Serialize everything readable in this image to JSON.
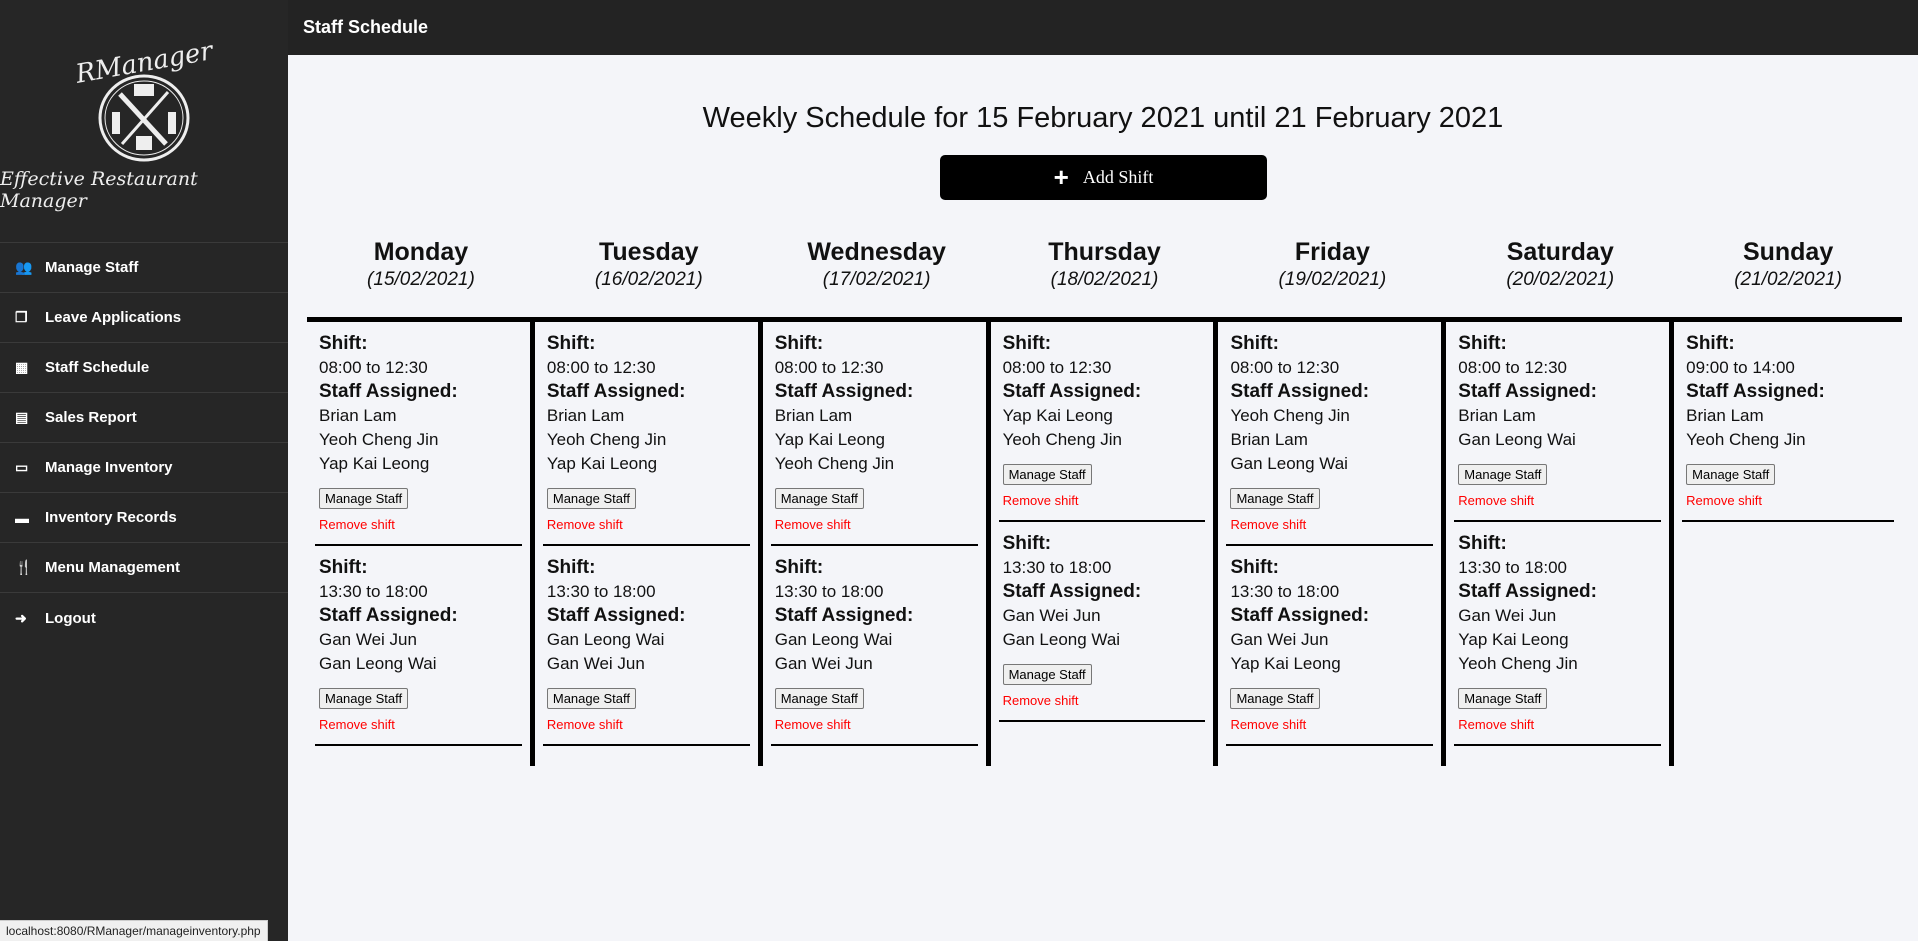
{
  "sidebar": {
    "logo_title": "RManager",
    "logo_subtitle": "Effective Restaurant Manager",
    "items": [
      {
        "label": "Manage Staff",
        "icon": "users-icon",
        "glyph": "👥"
      },
      {
        "label": "Leave Applications",
        "icon": "copy-icon",
        "glyph": "❐"
      },
      {
        "label": "Staff Schedule",
        "icon": "calendar-icon",
        "glyph": "▦"
      },
      {
        "label": "Sales Report",
        "icon": "file-icon",
        "glyph": "▤"
      },
      {
        "label": "Manage Inventory",
        "icon": "warehouse-icon",
        "glyph": "▭"
      },
      {
        "label": "Inventory Records",
        "icon": "book-icon",
        "glyph": "▬"
      },
      {
        "label": "Menu Management",
        "icon": "utensils-icon",
        "glyph": "🍴"
      },
      {
        "label": "Logout",
        "icon": "sign-out-icon",
        "glyph": "➜"
      }
    ]
  },
  "header": {
    "title": "Staff Schedule"
  },
  "main": {
    "title": "Weekly Schedule for 15 February 2021 until 21 February 2021",
    "add_shift": "Add Shift",
    "labels": {
      "shift": "Shift:",
      "staff": "Staff Assigned:",
      "manage": "Manage Staff",
      "remove": "Remove shift"
    },
    "days": [
      {
        "name": "Monday",
        "date": "(15/02/2021)",
        "shifts": [
          {
            "time": "08:00 to 12:30",
            "staff": [
              "Brian Lam",
              "Yeoh Cheng Jin",
              "Yap Kai Leong"
            ]
          },
          {
            "time": "13:30 to 18:00",
            "staff": [
              "Gan Wei Jun",
              "Gan Leong Wai"
            ]
          }
        ]
      },
      {
        "name": "Tuesday",
        "date": "(16/02/2021)",
        "shifts": [
          {
            "time": "08:00 to 12:30",
            "staff": [
              "Brian Lam",
              "Yeoh Cheng Jin",
              "Yap Kai Leong"
            ]
          },
          {
            "time": "13:30 to 18:00",
            "staff": [
              "Gan Leong Wai",
              "Gan Wei Jun"
            ]
          }
        ]
      },
      {
        "name": "Wednesday",
        "date": "(17/02/2021)",
        "shifts": [
          {
            "time": "08:00 to 12:30",
            "staff": [
              "Brian Lam",
              "Yap Kai Leong",
              "Yeoh Cheng Jin"
            ]
          },
          {
            "time": "13:30 to 18:00",
            "staff": [
              "Gan Leong Wai",
              "Gan Wei Jun"
            ]
          }
        ]
      },
      {
        "name": "Thursday",
        "date": "(18/02/2021)",
        "shifts": [
          {
            "time": "08:00 to 12:30",
            "staff": [
              "Yap Kai Leong",
              "Yeoh Cheng Jin"
            ]
          },
          {
            "time": "13:30 to 18:00",
            "staff": [
              "Gan Wei Jun",
              "Gan Leong Wai"
            ]
          }
        ]
      },
      {
        "name": "Friday",
        "date": "(19/02/2021)",
        "shifts": [
          {
            "time": "08:00 to 12:30",
            "staff": [
              "Yeoh Cheng Jin",
              "Brian Lam",
              "Gan Leong Wai"
            ]
          },
          {
            "time": "13:30 to 18:00",
            "staff": [
              "Gan Wei Jun",
              "Yap Kai Leong"
            ]
          }
        ]
      },
      {
        "name": "Saturday",
        "date": "(20/02/2021)",
        "shifts": [
          {
            "time": "08:00 to 12:30",
            "staff": [
              "Brian Lam",
              "Gan Leong Wai"
            ]
          },
          {
            "time": "13:30 to 18:00",
            "staff": [
              "Gan Wei Jun",
              "Yap Kai Leong",
              "Yeoh Cheng Jin"
            ]
          }
        ]
      },
      {
        "name": "Sunday",
        "date": "(21/02/2021)",
        "shifts": [
          {
            "time": "09:00 to 14:00",
            "staff": [
              "Brian Lam",
              "Yeoh Cheng Jin"
            ]
          }
        ]
      }
    ]
  },
  "status_bar": "localhost:8080/RManager/manageinventory.php"
}
